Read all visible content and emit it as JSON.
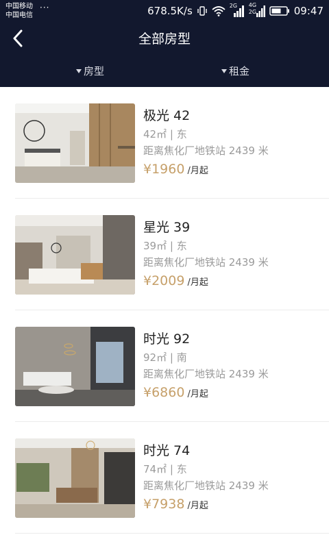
{
  "status_bar": {
    "carrier1": "中国移动",
    "carrier2": "中国电信",
    "more": "···",
    "speed": "678.5K/s",
    "network1": "2G",
    "network2": "4G",
    "network3": "2G",
    "time": "09:47"
  },
  "header": {
    "title": "全部房型",
    "back_icon": "chevron-left-icon"
  },
  "filters": [
    {
      "label": "房型",
      "icon": "triangle-down-icon"
    },
    {
      "label": "租金",
      "icon": "triangle-down-icon"
    }
  ],
  "colors": {
    "header_bg": "#12182e",
    "price": "#c6a06a",
    "title_text": "#222222",
    "secondary_text": "#9a9a9a"
  },
  "rooms": [
    {
      "name": "极光 42",
      "area": "42㎡",
      "orientation": "东",
      "distance": "距离焦化厂地铁站 2439 米",
      "price": "¥1960",
      "unit": "/月起"
    },
    {
      "name": "星光 39",
      "area": "39㎡",
      "orientation": "东",
      "distance": "距离焦化厂地铁站 2439 米",
      "price": "¥2009",
      "unit": "/月起"
    },
    {
      "name": "时光 92",
      "area": "92㎡",
      "orientation": "南",
      "distance": "距离焦化厂地铁站 2439 米",
      "price": "¥6860",
      "unit": "/月起"
    },
    {
      "name": "时光 74",
      "area": "74㎡",
      "orientation": "东",
      "distance": "距离焦化厂地铁站 2439 米",
      "price": "¥7938",
      "unit": "/月起"
    }
  ]
}
